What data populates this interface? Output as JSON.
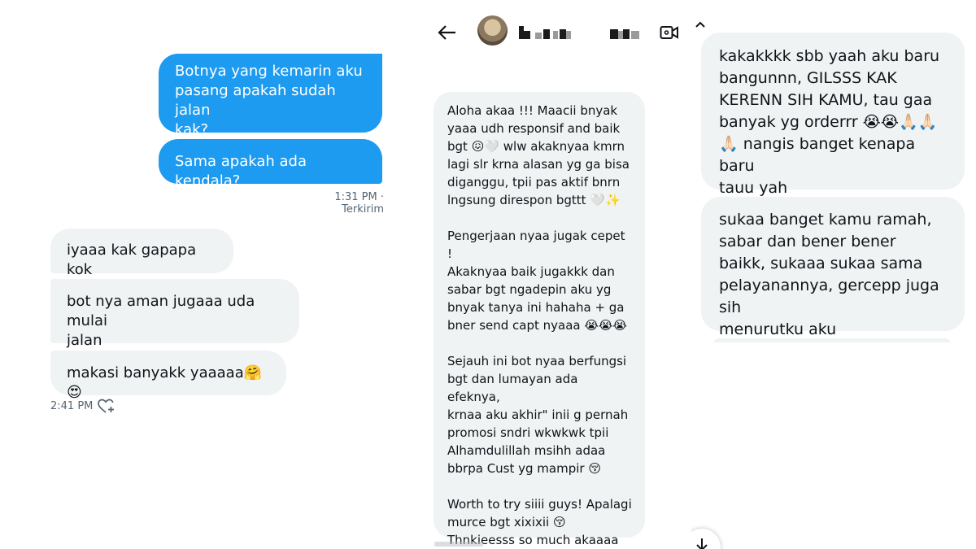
{
  "left_chat": {
    "sent": [
      "Botnya yang kemarin aku\npasang apakah sudah jalan\nkak?",
      "Sama apakah ada kendala?"
    ],
    "sent_time": "1:31 PM · Terkirim",
    "received": [
      "iyaaa kak gapapa kok",
      "bot nya aman jugaaa uda mulai\njalan",
      "makasi banyakk yaaaaa🤗😍"
    ],
    "received_time": "2:41 PM",
    "react_icon": "heart-plus-icon"
  },
  "middle_chat": {
    "header": {
      "back_icon": "back-arrow-icon",
      "avatar_icon": "avatar",
      "video_icon": "video-camera-icon"
    },
    "message": "Aloha akaa !!! Maacii bnyak\nyaaa udh responsif and baik\nbgt 😖🤍 wlw akaknyaa kmrn\nlagi slr krna alasan yg ga bisa\ndiganggu, tpii pas aktif bnrn\nlngsung direspon bgttt 🤍✨\n\nPengerjaan nyaa jugak cepet !\nAkaknyaa baik jugakkk dan\nsabar bgt ngadepin aku yg\nbnyak tanya ini hahaha + ga\nbner send capt nyaaa 😭😭😭\n\nSejauh ini bot nyaa berfungsi\nbgt dan lumayan ada efeknya,\nkrnaa aku akhir\" inii g pernah\npromosi sndri wkwkwk tpii\nAlhamdulillah msihh adaa\nbbrpa Cust yg mampir 😚\n\nWorth to try siiii guys! Apalagi\nmurce bgt xixixii 😚\nThnkieesss so much akaaaa\nPOKOKNYA 😚🤍✨"
  },
  "right_chat": {
    "collapse_icon": "chevron-up-icon",
    "messages": [
      "kakakkkk sbb yaah aku baru\nbangunnn, GILSSS KAK\nKERENN SIH KAMU, tau gaa\nbanyak yg orderrr 😭😭🙏🏻🙏🏻\n🙏🏻 nangis banget kenapa baru\ntauu yah",
      "sukaa banget kamu ramah,\nsabar dan bener bener\nbaikk, sukaaa sukaa sama\npelayanannya, gercepp juga sih\nmenurutku aku"
    ],
    "scroll_icon": "scroll-down-icon"
  }
}
